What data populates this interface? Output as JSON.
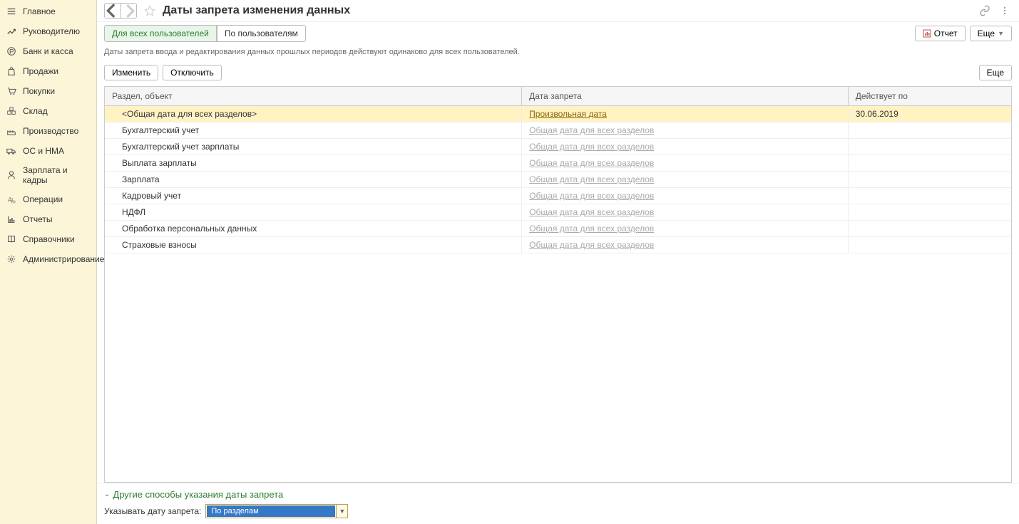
{
  "sidebar": {
    "items": [
      {
        "label": "Главное",
        "icon": "menu"
      },
      {
        "label": "Руководителю",
        "icon": "trend"
      },
      {
        "label": "Банк и касса",
        "icon": "ruble"
      },
      {
        "label": "Продажи",
        "icon": "bag"
      },
      {
        "label": "Покупки",
        "icon": "cart"
      },
      {
        "label": "Склад",
        "icon": "boxes"
      },
      {
        "label": "Производство",
        "icon": "factory"
      },
      {
        "label": "ОС и НМА",
        "icon": "truck"
      },
      {
        "label": "Зарплата и кадры",
        "icon": "person"
      },
      {
        "label": "Операции",
        "icon": "doc"
      },
      {
        "label": "Отчеты",
        "icon": "chart"
      },
      {
        "label": "Справочники",
        "icon": "book"
      },
      {
        "label": "Администрирование",
        "icon": "gear"
      }
    ]
  },
  "header": {
    "title": "Даты запрета изменения данных"
  },
  "tabs": [
    {
      "label": "Для всех пользователей",
      "active": true
    },
    {
      "label": "По пользователям",
      "active": false
    }
  ],
  "buttons": {
    "report": "Отчет",
    "more": "Еще",
    "edit": "Изменить",
    "disable": "Отключить"
  },
  "description": "Даты запрета ввода и редактирования данных прошлых периодов действуют одинаково для всех пользователей.",
  "table": {
    "columns": [
      "Раздел, объект",
      "Дата запрета",
      "Действует по"
    ],
    "rows": [
      {
        "section": "<Общая дата для всех разделов>",
        "date_label": "Произвольная дата",
        "date_link_active": true,
        "effective": "30.06.2019",
        "selected": true
      },
      {
        "section": "Бухгалтерский учет",
        "date_label": "Общая дата для всех разделов",
        "date_link_active": false,
        "effective": ""
      },
      {
        "section": "Бухгалтерский учет зарплаты",
        "date_label": "Общая дата для всех разделов",
        "date_link_active": false,
        "effective": ""
      },
      {
        "section": "Выплата зарплаты",
        "date_label": "Общая дата для всех разделов",
        "date_link_active": false,
        "effective": ""
      },
      {
        "section": "Зарплата",
        "date_label": "Общая дата для всех разделов",
        "date_link_active": false,
        "effective": ""
      },
      {
        "section": "Кадровый учет",
        "date_label": "Общая дата для всех разделов",
        "date_link_active": false,
        "effective": ""
      },
      {
        "section": "НДФЛ",
        "date_label": "Общая дата для всех разделов",
        "date_link_active": false,
        "effective": ""
      },
      {
        "section": "Обработка персональных данных",
        "date_label": "Общая дата для всех разделов",
        "date_link_active": false,
        "effective": ""
      },
      {
        "section": "Страховые взносы",
        "date_label": "Общая дата для всех разделов",
        "date_link_active": false,
        "effective": ""
      }
    ]
  },
  "footer": {
    "collapse_title": "Другие способы указания даты запрета",
    "field_label": "Указывать дату запрета:",
    "select_value": "По разделам"
  }
}
